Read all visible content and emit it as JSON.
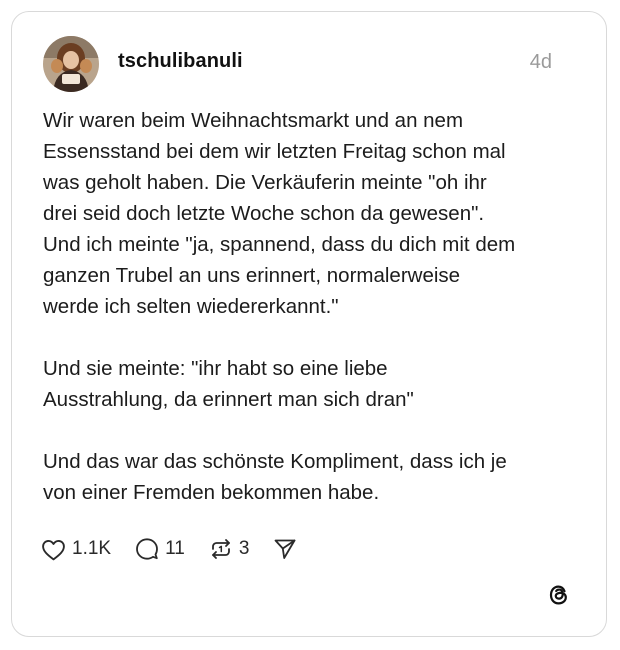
{
  "post": {
    "username": "tschulibanuli",
    "timestamp": "4d",
    "paragraphs": [
      "Wir waren beim Weihnachtsmarkt und an nem\nEssensstand bei dem wir letzten Freitag schon mal\nwas geholt haben. Die Verkäuferin meinte \"oh ihr\ndrei seid doch letzte Woche schon da gewesen\".\nUnd ich meinte \"ja, spannend, dass du dich mit dem\nganzen Trubel an uns erinnert, normalerweise\nwerde ich selten wiedererkannt.\"",
      "Und sie meinte: \"ihr habt so eine liebe\nAusstrahlung, da erinnert man sich dran\"",
      "Und das war das schönste Kompliment, dass ich je\nvon einer Fremden bekommen habe."
    ]
  },
  "actions": {
    "likes": "1.1K",
    "replies": "11",
    "reposts": "3"
  },
  "icons": {
    "like": "heart-icon",
    "reply": "comment-icon",
    "repost": "repost-icon",
    "share": "send-icon",
    "brand": "threads-logo-icon"
  },
  "colors": {
    "border": "#d9d9d9",
    "timestamp": "#9a9a9a",
    "text": "#1c1c1c"
  }
}
